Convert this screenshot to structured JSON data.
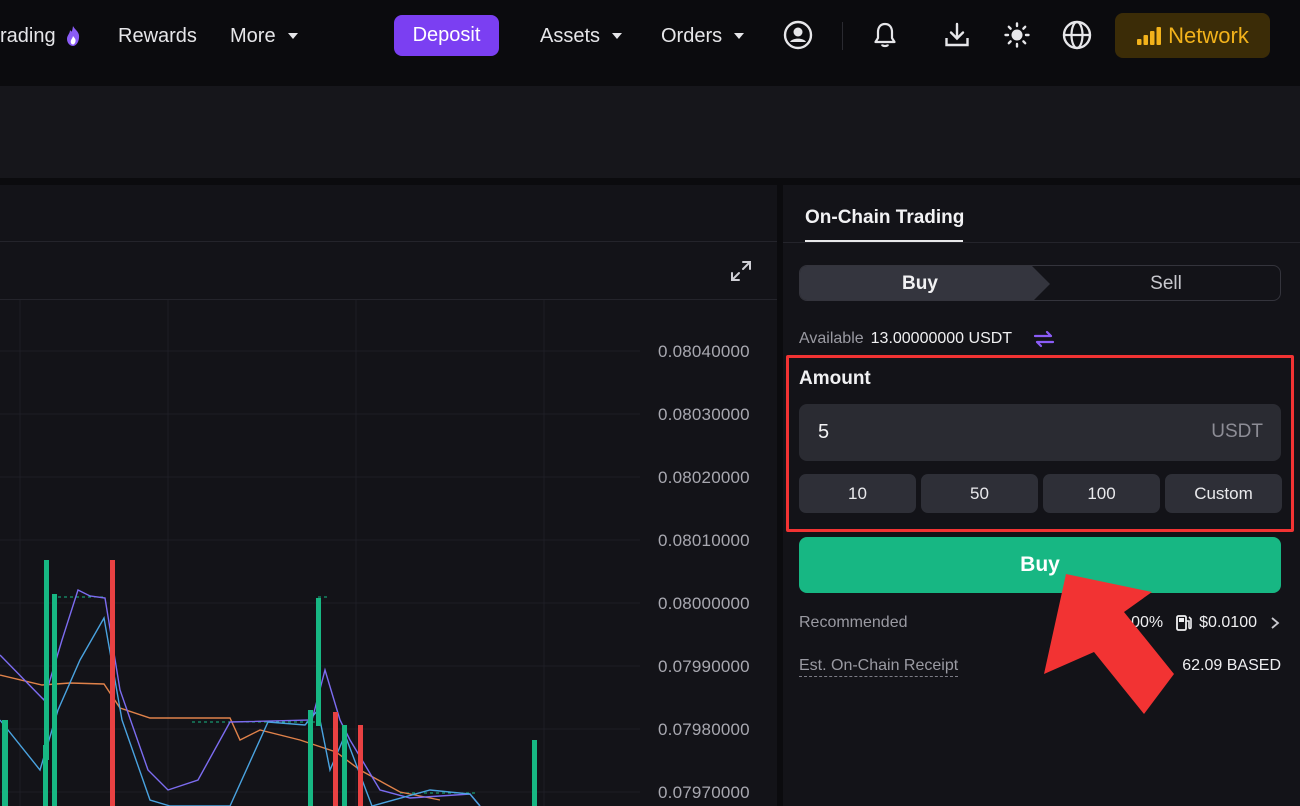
{
  "nav": {
    "trading_label": "rading",
    "rewards_label": "Rewards",
    "more_label": "More",
    "deposit_label": "Deposit",
    "assets_label": "Assets",
    "orders_label": "Orders",
    "network_label": "Network"
  },
  "chart": {
    "y_tick_labels": [
      "0.08040000",
      "0.08030000",
      "0.08020000",
      "0.08010000",
      "0.08000000",
      "0.07990000",
      "0.07980000",
      "0.07970000"
    ]
  },
  "trade_panel": {
    "tab_label": "On-Chain Trading",
    "buy_tab": "Buy",
    "sell_tab": "Sell",
    "available_label": "Available",
    "available_value": "13.00000000 USDT",
    "amount_label": "Amount",
    "amount_value": "5",
    "amount_unit": "USDT",
    "presets": [
      "10",
      "50",
      "100",
      "Custom"
    ],
    "buy_button": "Buy",
    "recommended_label": "Recommended",
    "slippage_partial": "00%",
    "gas_fee": "$0.0100",
    "receipt_label": "Est. On-Chain Receipt",
    "receipt_value": "62.09 BASED"
  },
  "colors": {
    "accent_purple": "#7b3ff2",
    "buy_green": "#17b783",
    "candle_red": "#e84142",
    "network_gold": "#f2b21b",
    "highlight_red": "#f23333"
  }
}
